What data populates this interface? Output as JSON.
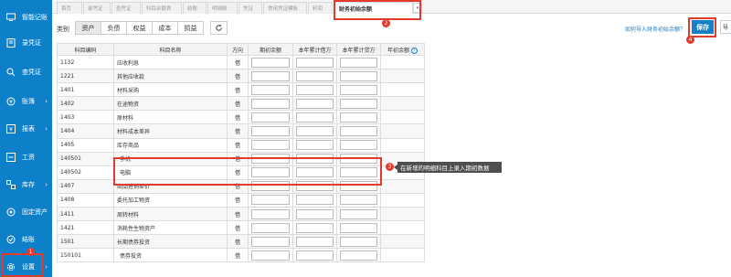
{
  "sidebar": {
    "items": [
      {
        "label": "智能记账",
        "icon": "monitor-icon"
      },
      {
        "label": "录凭证",
        "icon": "voucher-icon"
      },
      {
        "label": "查凭证",
        "icon": "search-voucher-icon"
      },
      {
        "label": "账簿",
        "icon": "ledger-icon"
      },
      {
        "label": "报表",
        "icon": "report-icon"
      },
      {
        "label": "工资",
        "icon": "salary-icon"
      },
      {
        "label": "库存",
        "icon": "inventory-icon"
      },
      {
        "label": "固定资产",
        "icon": "fixed-asset-icon"
      },
      {
        "label": "结账",
        "icon": "close-book-icon"
      },
      {
        "label": "设置",
        "icon": "settings-icon"
      }
    ],
    "settings_badge": "1"
  },
  "tabs": {
    "items": [
      "首页",
      "录凭证",
      "查凭证",
      "科目余额表",
      "结账",
      "明细账",
      "凭证",
      "常用凭证模板",
      "利润",
      "财务初始余额"
    ],
    "active": "财务初始余额",
    "active_badge": "2",
    "dropdown_symbol": "▾"
  },
  "toolbar": {
    "category_label": "类别",
    "categories": [
      "资产",
      "负债",
      "权益",
      "成本",
      "损益"
    ],
    "active_category": "资产",
    "import_link": "如何导入财务初始余额？",
    "save_label": "保存",
    "save_badge": "4",
    "import_label": "导"
  },
  "table": {
    "headers": [
      "科目编码",
      "科目名称",
      "方向",
      "期初余额",
      "本年累计借方",
      "本年累计贷方",
      "年初余额"
    ],
    "rows": [
      {
        "code": "1132",
        "name": "应收利息",
        "dir": "借"
      },
      {
        "code": "1221",
        "name": "其他应收款",
        "dir": "借"
      },
      {
        "code": "1401",
        "name": "材料采购",
        "dir": "借"
      },
      {
        "code": "1402",
        "name": "在途物资",
        "dir": "借"
      },
      {
        "code": "1403",
        "name": "原材料",
        "dir": "借"
      },
      {
        "code": "1404",
        "name": "材料成本差异",
        "dir": "借"
      },
      {
        "code": "1405",
        "name": "库存商品",
        "dir": "借"
      },
      {
        "code": "140501",
        "name": "手机",
        "dir": "借"
      },
      {
        "code": "140502",
        "name": "电脑",
        "dir": "借"
      },
      {
        "code": "1407",
        "name": "商品进销差价",
        "dir": "借"
      },
      {
        "code": "1408",
        "name": "委托加工物资",
        "dir": "借"
      },
      {
        "code": "1411",
        "name": "周转材料",
        "dir": "借"
      },
      {
        "code": "1421",
        "name": "消耗性生物资产",
        "dir": "借"
      },
      {
        "code": "1501",
        "name": "长期债券投资",
        "dir": "借"
      },
      {
        "code": "150101",
        "name": "债券投资",
        "dir": "借"
      }
    ]
  },
  "annotation": {
    "text": "在新增的明细科目上录入期初数据",
    "badge": "3"
  },
  "colors": {
    "sidebar": "#0e7fc9",
    "highlight": "#e23b2e",
    "accent": "#167fc8"
  }
}
